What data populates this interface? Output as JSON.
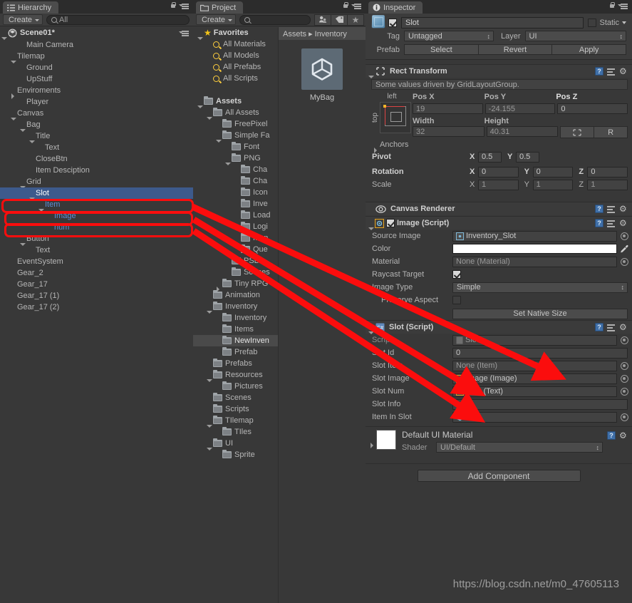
{
  "hierarchy": {
    "tab": "Hierarchy",
    "create_label": "Create",
    "search_placeholder": "All",
    "scene": "Scene01*",
    "items": [
      {
        "label": "Main Camera",
        "depth": 2,
        "arrow": "none",
        "state": "normal"
      },
      {
        "label": "Tilemap",
        "depth": 1,
        "arrow": "down",
        "state": "normal"
      },
      {
        "label": "Ground",
        "depth": 2,
        "arrow": "none",
        "state": "normal"
      },
      {
        "label": "UpStuff",
        "depth": 2,
        "arrow": "none",
        "state": "normal"
      },
      {
        "label": "Enviroments",
        "depth": 1,
        "arrow": "right",
        "state": "normal"
      },
      {
        "label": "Player",
        "depth": 2,
        "arrow": "none",
        "state": "normal"
      },
      {
        "label": "Canvas",
        "depth": 1,
        "arrow": "down",
        "state": "normal"
      },
      {
        "label": "Bag",
        "depth": 2,
        "arrow": "down",
        "state": "normal"
      },
      {
        "label": "Title",
        "depth": 3,
        "arrow": "down",
        "state": "normal"
      },
      {
        "label": "Text",
        "depth": 4,
        "arrow": "none",
        "state": "normal"
      },
      {
        "label": "CloseBtn",
        "depth": 3,
        "arrow": "none",
        "state": "normal"
      },
      {
        "label": "Item Desciption",
        "depth": 3,
        "arrow": "none",
        "state": "normal"
      },
      {
        "label": "Grid",
        "depth": 2,
        "arrow": "down",
        "state": "normal"
      },
      {
        "label": "Slot",
        "depth": 3,
        "arrow": "down",
        "state": "selected"
      },
      {
        "label": "Item",
        "depth": 4,
        "arrow": "down",
        "state": "blue"
      },
      {
        "label": "Image",
        "depth": 5,
        "arrow": "none",
        "state": "blue"
      },
      {
        "label": "num",
        "depth": 5,
        "arrow": "none",
        "state": "blue"
      },
      {
        "label": "Button",
        "depth": 2,
        "arrow": "down",
        "state": "normal"
      },
      {
        "label": "Text",
        "depth": 3,
        "arrow": "none",
        "state": "normal"
      },
      {
        "label": "EventSystem",
        "depth": 1,
        "arrow": "none",
        "state": "normal"
      },
      {
        "label": "Gear_2",
        "depth": 1,
        "arrow": "none",
        "state": "normal"
      },
      {
        "label": "Gear_17",
        "depth": 1,
        "arrow": "none",
        "state": "normal"
      },
      {
        "label": "Gear_17 (1)",
        "depth": 1,
        "arrow": "none",
        "state": "normal"
      },
      {
        "label": "Gear_17 (2)",
        "depth": 1,
        "arrow": "none",
        "state": "normal"
      }
    ]
  },
  "project": {
    "tab": "Project",
    "create_label": "Create",
    "search_placeholder": "",
    "toolbar_icons": [
      "avatar-filter-icon",
      "label-filter-icon",
      "favorite-star-icon"
    ],
    "breadcrumb": "Assets ▸ Inventory",
    "asset_name": "MyBag",
    "tree": [
      {
        "label": "Favorites",
        "depth": 0,
        "arrow": "down",
        "icon": "star",
        "bold": true
      },
      {
        "label": "All Materials",
        "depth": 1,
        "arrow": "none",
        "icon": "search"
      },
      {
        "label": "All Models",
        "depth": 1,
        "arrow": "none",
        "icon": "search"
      },
      {
        "label": "All Prefabs",
        "depth": 1,
        "arrow": "none",
        "icon": "search"
      },
      {
        "label": "All Scripts",
        "depth": 1,
        "arrow": "none",
        "icon": "search"
      },
      {
        "label": "",
        "depth": 0,
        "arrow": "none",
        "icon": "none"
      },
      {
        "label": "Assets",
        "depth": 0,
        "arrow": "down",
        "icon": "folder",
        "bold": true
      },
      {
        "label": "All Assets",
        "depth": 1,
        "arrow": "down",
        "icon": "folder"
      },
      {
        "label": "FreePixel",
        "depth": 2,
        "arrow": "none",
        "icon": "folder"
      },
      {
        "label": "Simple Fa",
        "depth": 2,
        "arrow": "down",
        "icon": "folder"
      },
      {
        "label": "Font",
        "depth": 3,
        "arrow": "none",
        "icon": "folder"
      },
      {
        "label": "PNG",
        "depth": 3,
        "arrow": "down",
        "icon": "folder"
      },
      {
        "label": "Cha",
        "depth": 4,
        "arrow": "none",
        "icon": "folder"
      },
      {
        "label": "Cha",
        "depth": 4,
        "arrow": "none",
        "icon": "folder"
      },
      {
        "label": "Icon",
        "depth": 4,
        "arrow": "none",
        "icon": "folder"
      },
      {
        "label": "Inve",
        "depth": 4,
        "arrow": "none",
        "icon": "folder"
      },
      {
        "label": "Load",
        "depth": 4,
        "arrow": "none",
        "icon": "folder"
      },
      {
        "label": "Logi",
        "depth": 4,
        "arrow": "none",
        "icon": "folder"
      },
      {
        "label": "Men",
        "depth": 4,
        "arrow": "none",
        "icon": "folder"
      },
      {
        "label": "Que",
        "depth": 4,
        "arrow": "none",
        "icon": "folder"
      },
      {
        "label": "PSD",
        "depth": 3,
        "arrow": "none",
        "icon": "folder"
      },
      {
        "label": "Scenes",
        "depth": 3,
        "arrow": "none",
        "icon": "folder"
      },
      {
        "label": "Tiny RPG",
        "depth": 2,
        "arrow": "right",
        "icon": "folder"
      },
      {
        "label": "Animation",
        "depth": 1,
        "arrow": "none",
        "icon": "folder"
      },
      {
        "label": "Inventory",
        "depth": 1,
        "arrow": "down",
        "icon": "folder"
      },
      {
        "label": "Inventory",
        "depth": 2,
        "arrow": "none",
        "icon": "folder"
      },
      {
        "label": "Items",
        "depth": 2,
        "arrow": "none",
        "icon": "folder"
      },
      {
        "label": "NewInven",
        "depth": 2,
        "arrow": "none",
        "icon": "folder",
        "state": "selected-gray"
      },
      {
        "label": "Prefab",
        "depth": 2,
        "arrow": "none",
        "icon": "folder"
      },
      {
        "label": "Prefabs",
        "depth": 1,
        "arrow": "none",
        "icon": "folder"
      },
      {
        "label": "Resources",
        "depth": 1,
        "arrow": "down",
        "icon": "folder"
      },
      {
        "label": "Pictures",
        "depth": 2,
        "arrow": "none",
        "icon": "folder"
      },
      {
        "label": "Scenes",
        "depth": 1,
        "arrow": "none",
        "icon": "folder"
      },
      {
        "label": "Scripts",
        "depth": 1,
        "arrow": "none",
        "icon": "folder"
      },
      {
        "label": "TIlemap",
        "depth": 1,
        "arrow": "down",
        "icon": "folder"
      },
      {
        "label": "TIles",
        "depth": 2,
        "arrow": "none",
        "icon": "folder"
      },
      {
        "label": "UI",
        "depth": 1,
        "arrow": "down",
        "icon": "folder"
      },
      {
        "label": "Sprite",
        "depth": 2,
        "arrow": "none",
        "icon": "folder"
      }
    ]
  },
  "inspector": {
    "tab": "Inspector",
    "object_name": "Slot",
    "enabled": true,
    "static_label": "Static",
    "static_checked": false,
    "tag_label": "Tag",
    "tag_value": "Untagged",
    "layer_label": "Layer",
    "layer_value": "UI",
    "prefab_label": "Prefab",
    "prefab_buttons": [
      "Select",
      "Revert",
      "Apply"
    ],
    "rect_transform": {
      "title": "Rect Transform",
      "driven_note": "Some values driven by GridLayoutGroup.",
      "anchor_preset_left": "left",
      "anchor_preset_top": "top",
      "pos_x_label": "Pos X",
      "pos_x": "19",
      "pos_y_label": "Pos Y",
      "pos_y": "-24.155",
      "pos_z_label": "Pos Z",
      "pos_z": "0",
      "width_label": "Width",
      "width": "32",
      "height_label": "Height",
      "height": "40.31",
      "blueprint_label": "",
      "raw_label": "R",
      "anchors_label": "Anchors",
      "pivot_label": "Pivot",
      "pivot_x": "0.5",
      "pivot_y": "0.5",
      "rotation_label": "Rotation",
      "rot_x": "0",
      "rot_y": "0",
      "rot_z": "0",
      "scale_label": "Scale",
      "scale_x": "1",
      "scale_y": "1",
      "scale_z": "1"
    },
    "canvas_renderer": {
      "title": "Canvas Renderer"
    },
    "image_script": {
      "title": "Image (Script)",
      "enabled": true,
      "source_image_label": "Source Image",
      "source_image": "Inventory_Slot",
      "color_label": "Color",
      "color_value": "#FFFFFF",
      "material_label": "Material",
      "material": "None (Material)",
      "raycast_label": "Raycast Target",
      "raycast_checked": true,
      "image_type_label": "Image Type",
      "image_type": "Simple",
      "preserve_label": "Preserve Aspect",
      "preserve_checked": false,
      "native_size_button": "Set Native Size"
    },
    "slot_script": {
      "title": "Slot (Script)",
      "script_label": "Script",
      "script_value": "Slot",
      "slot_id_label": "Slot Id",
      "slot_id": "0",
      "slot_item_label": "Slot Item",
      "slot_item": "None (Item)",
      "slot_image_label": "Slot Image",
      "slot_image": "Image (Image)",
      "slot_num_label": "Slot Num",
      "slot_num": "num (Text)",
      "slot_info_label": "Slot Info",
      "slot_info": "",
      "item_in_slot_label": "Item In Slot",
      "item_in_slot": "Item"
    },
    "material": {
      "title": "Default UI Material",
      "shader_label": "Shader",
      "shader_value": "UI/Default"
    },
    "add_component_label": "Add Component"
  },
  "watermark": "https://blog.csdn.net/m0_47605113",
  "colors": {
    "selection_blue": "#3d5a8c",
    "annotation_red": "#fb0d0d",
    "panel_bg": "#383838",
    "text": "#b4b4b4",
    "link_blue": "#5d8fd6"
  }
}
